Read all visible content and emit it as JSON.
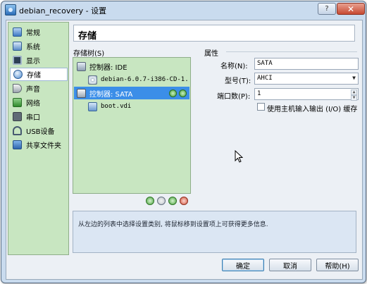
{
  "window": {
    "title": "debian_recovery - 设置",
    "help_glyph": "?",
    "close_glyph": "✕"
  },
  "sidebar": {
    "items": [
      {
        "label": "常规",
        "icon": "general-icon"
      },
      {
        "label": "系统",
        "icon": "system-icon"
      },
      {
        "label": "显示",
        "icon": "display-icon"
      },
      {
        "label": "存储",
        "icon": "storage-icon",
        "selected": true
      },
      {
        "label": "声音",
        "icon": "audio-icon"
      },
      {
        "label": "网络",
        "icon": "network-icon"
      },
      {
        "label": "串口",
        "icon": "serial-port-icon"
      },
      {
        "label": "USB设备",
        "icon": "usb-icon"
      },
      {
        "label": "共享文件夹",
        "icon": "shared-folder-icon"
      }
    ]
  },
  "page": {
    "title": "存储"
  },
  "storage_tree": {
    "label": "存储树(S)",
    "rows": [
      {
        "text": "控制器: IDE",
        "icon": "ide-controller-icon"
      },
      {
        "text": "debian-6.0.7-i386-CD-1....",
        "icon": "cd-disk-icon"
      },
      {
        "text": "控制器: SATA",
        "icon": "sata-controller-icon",
        "selected": true
      },
      {
        "text": "boot.vdi",
        "icon": "hard-disk-icon"
      }
    ]
  },
  "attributes": {
    "section_label": "属性",
    "name_label": "名称(N):",
    "name_value": "SATA",
    "type_label": "型号(T):",
    "type_value": "AHCI",
    "ports_label": "端口数(P):",
    "ports_value": "1",
    "cache_label": "使用主机输入输出 (I/O) 缓存",
    "cache_checked": false
  },
  "info": {
    "text": "从左边的列表中选择设置类别, 将鼠标移到设置项上可获得更多信息."
  },
  "buttons": {
    "ok": "确定",
    "cancel": "取消",
    "help": "帮助(H)"
  }
}
